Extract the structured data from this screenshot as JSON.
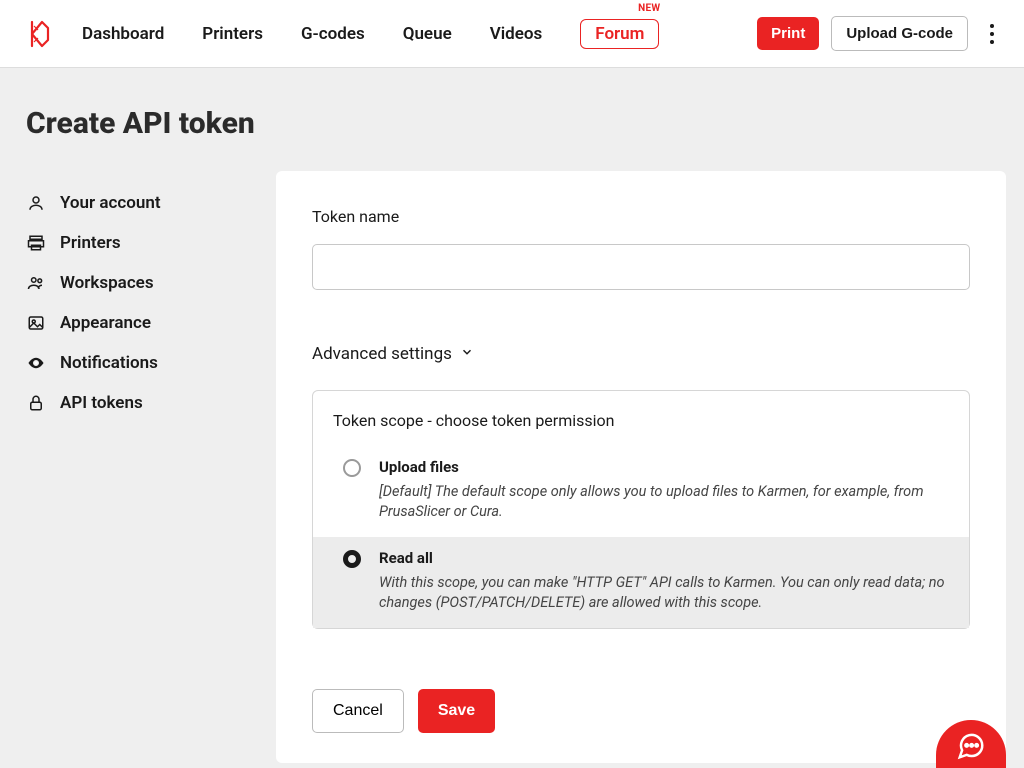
{
  "header": {
    "nav": [
      "Dashboard",
      "Printers",
      "G-codes",
      "Queue",
      "Videos",
      "Forum"
    ],
    "new_badge": "NEW",
    "print_btn": "Print",
    "upload_btn": "Upload G-code"
  },
  "page_title": "Create API token",
  "sidebar": {
    "items": [
      {
        "label": "Your account",
        "icon": "user"
      },
      {
        "label": "Printers",
        "icon": "printer"
      },
      {
        "label": "Workspaces",
        "icon": "users"
      },
      {
        "label": "Appearance",
        "icon": "image"
      },
      {
        "label": "Notifications",
        "icon": "eye"
      },
      {
        "label": "API tokens",
        "icon": "lock"
      }
    ]
  },
  "form": {
    "token_name_label": "Token name",
    "token_name_value": "",
    "advanced_label": "Advanced settings",
    "scope_title": "Token scope - choose token permission",
    "options": [
      {
        "label": "Upload files",
        "desc": "[Default] The default scope only allows you to upload files to Karmen, for example, from PrusaSlicer or Cura.",
        "selected": false
      },
      {
        "label": "Read all",
        "desc": "With this scope, you can make \"HTTP GET\" API calls to Karmen. You can only read data; no changes (POST/PATCH/DELETE) are allowed with this scope.",
        "selected": true
      }
    ],
    "cancel": "Cancel",
    "save": "Save"
  },
  "colors": {
    "accent": "#ea2323"
  }
}
